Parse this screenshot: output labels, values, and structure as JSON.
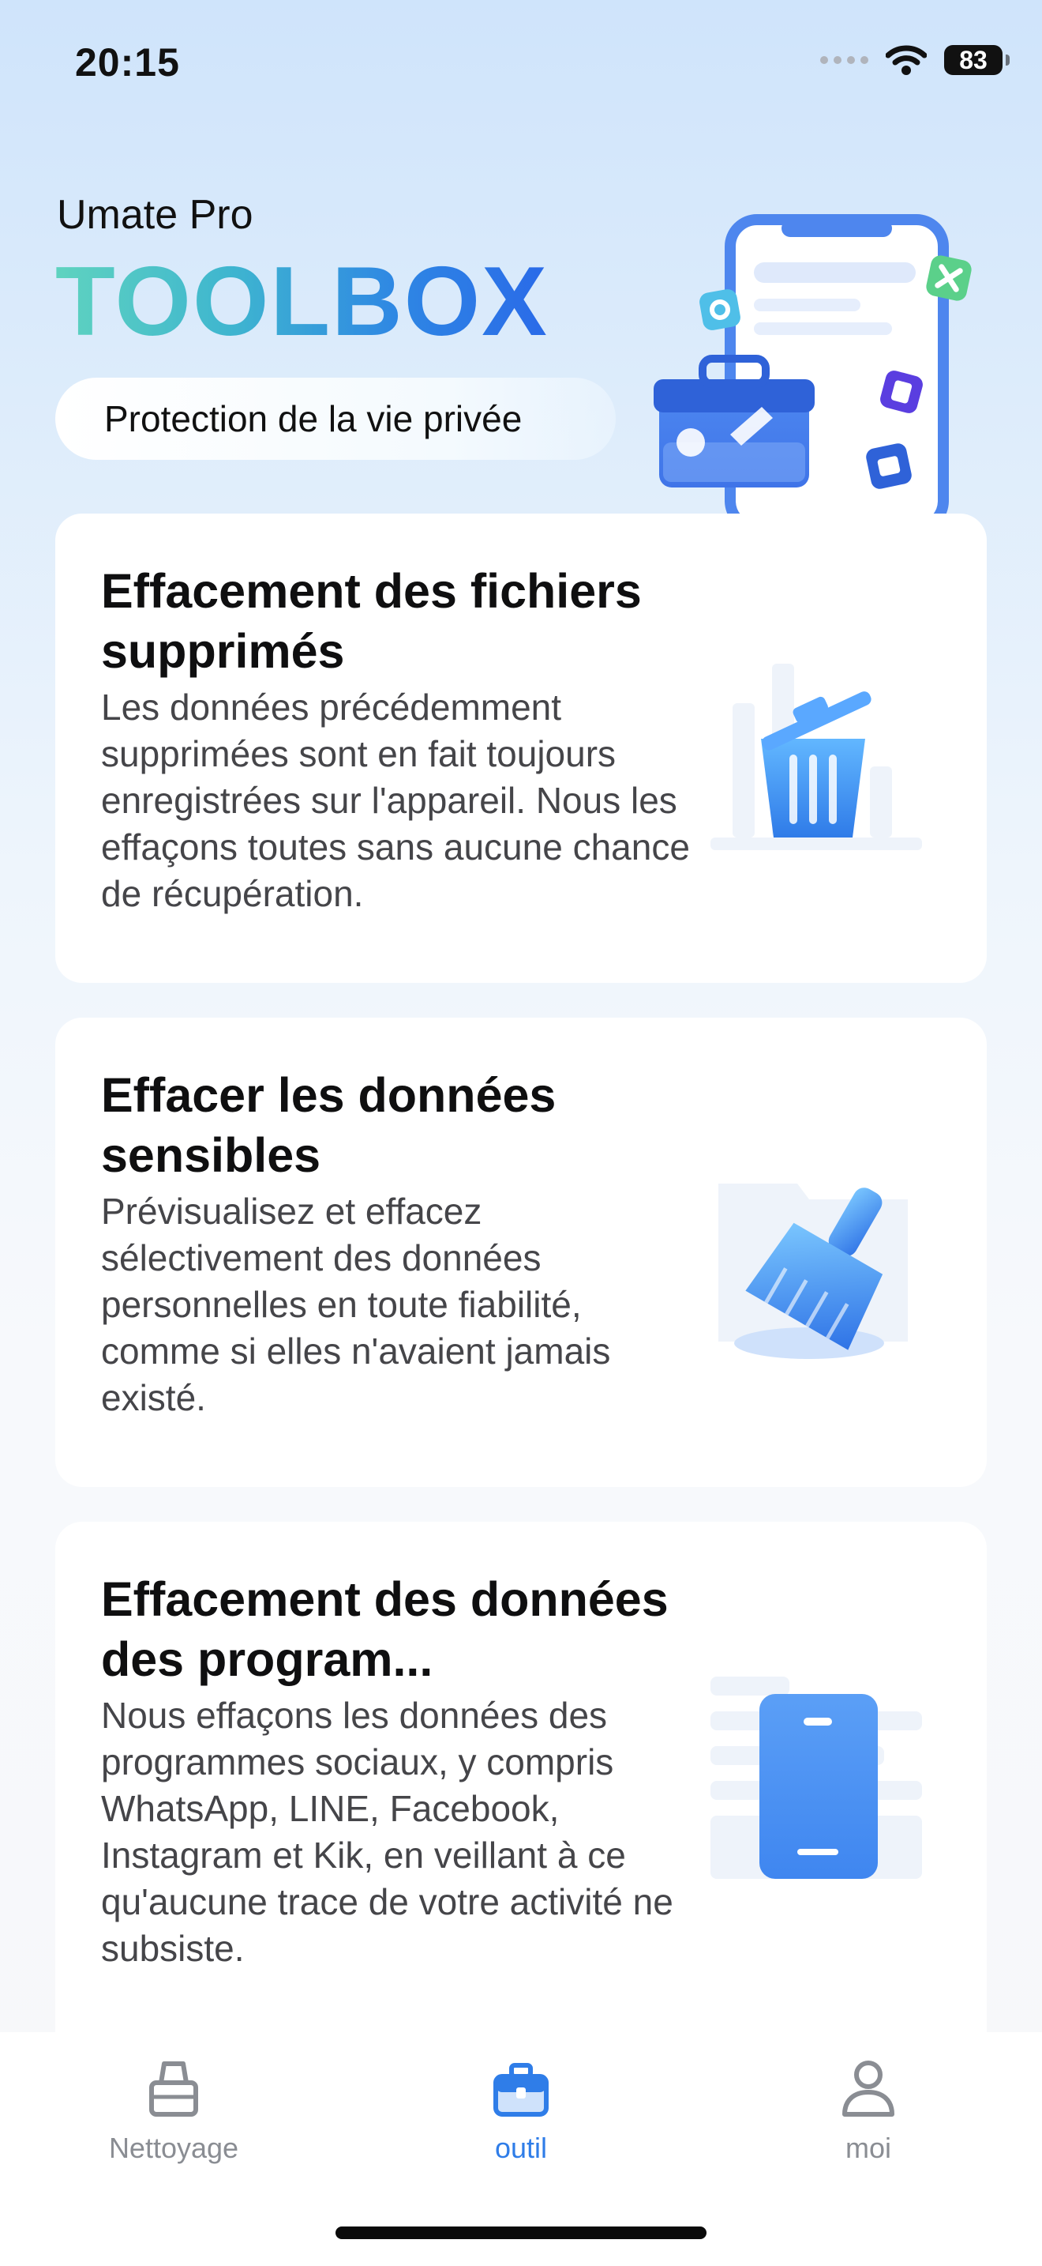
{
  "status": {
    "time": "20:15",
    "battery": "83"
  },
  "header": {
    "brand": "Umate Pro",
    "title": "TOOLBOX",
    "privacy_button": "Protection de la vie privée"
  },
  "cards": [
    {
      "title": "Effacement des fichiers supprimés",
      "description": "Les données précédemment supprimées sont en fait toujours enregistrées sur l'appareil. Nous les effaçons toutes sans aucune chance de récupération.",
      "icon": "trash-bin-icon"
    },
    {
      "title": "Effacer les données sensibles",
      "description": "Prévisualisez et effacez sélectivement des données personnelles en toute fiabilité, comme si elles n'avaient jamais existé.",
      "icon": "broom-icon"
    },
    {
      "title": "Effacement des données des program...",
      "description": "Nous effaçons les données des programmes sociaux, y compris WhatsApp, LINE, Facebook, Instagram et Kik, en veillant à ce qu'aucune trace de votre activité ne subsiste.",
      "icon": "phone-icon"
    }
  ],
  "tabs": [
    {
      "label": "Nettoyage",
      "icon": "cleaning-box-icon",
      "active": false
    },
    {
      "label": "outil",
      "icon": "toolbox-icon",
      "active": true
    },
    {
      "label": "moi",
      "icon": "person-icon",
      "active": false
    }
  ],
  "colors": {
    "accent": "#2f7de8",
    "inactive": "#8a8d93"
  }
}
